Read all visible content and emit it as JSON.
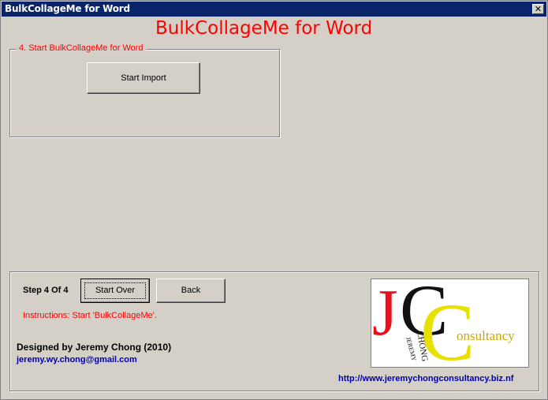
{
  "window": {
    "title": "BulkCollageMe for Word",
    "close_glyph": "✕"
  },
  "heading": "BulkCollageMe for Word",
  "group_start": {
    "label": "4. Start BulkCollageMe for Word",
    "import_button": "Start Import"
  },
  "footer": {
    "step": "Step 4 Of 4",
    "start_over_button": "Start Over",
    "back_button": "Back",
    "instructions": "Instructions: Start 'BulkCollageMe'.",
    "designed_by": "Designed by Jeremy Chong  (2010)",
    "email": "jeremy.wy.chong@gmail.com",
    "url": "http://www.jeremychongconsultancy.biz.nf"
  },
  "logo": {
    "letter_j": "J",
    "letter_c_black": "C",
    "letter_c_yellow": "C",
    "consultancy": "onsultancy",
    "chong_vertical": "CHONG",
    "jeremy_vertical": "JEREMY"
  },
  "colors": {
    "title_bar": "#0a246a",
    "heading_red": "#ff0000",
    "link_blue": "#0000aa",
    "logo_red": "#e8101c",
    "logo_yellow": "#e8e000"
  }
}
